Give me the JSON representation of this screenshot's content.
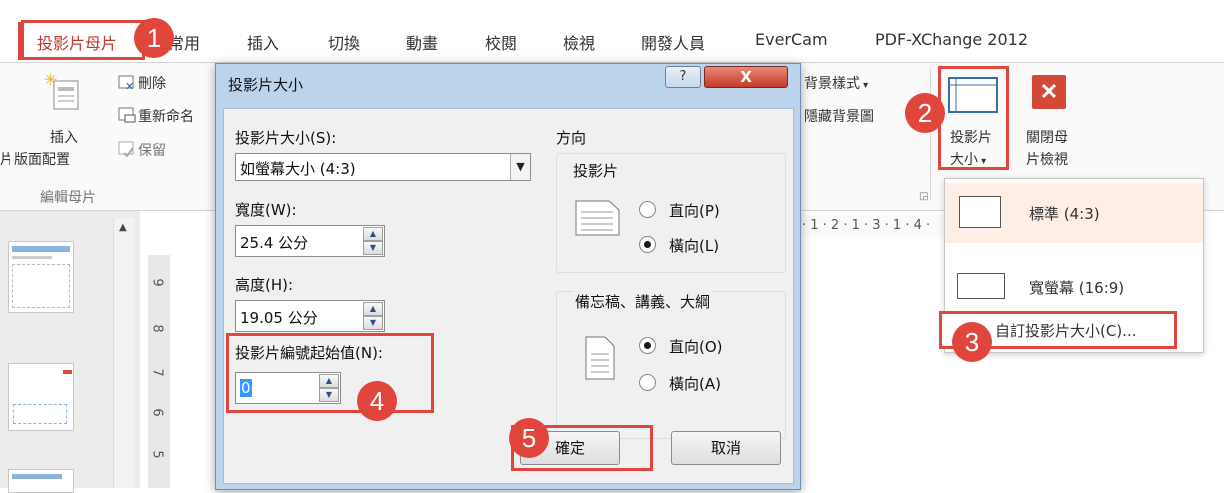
{
  "ribbon_tabs": [
    "投影片母片",
    "常用",
    "插入",
    "切換",
    "動畫",
    "校閱",
    "檢視",
    "開發人員",
    "EverCam",
    "PDF-XChange 2012"
  ],
  "ribbon": {
    "insert_layout_1": "插入",
    "insert_layout_2": "版面配置",
    "left_edge_char": "片",
    "delete": "刪除",
    "rename": "重新命名",
    "preserve": "保留",
    "group_edit_master": "編輯母片",
    "bg_styles": "背景樣式",
    "hide_bg": "隱藏背景圖",
    "slide_size_1": "投影片",
    "slide_size_2": "大小",
    "close_master_1": "關閉母",
    "close_master_2": "片檢視"
  },
  "ruler_marks": "· 1 · 2 · 1 · 3 · 1 · 4 ·",
  "vruler_marks": [
    "9",
    "8",
    "7",
    "6",
    "5"
  ],
  "dialog": {
    "title": "投影片大小",
    "help": "?",
    "close": "X",
    "slide_size_label": "投影片大小(S):",
    "slide_size_value": "如螢幕大小 (4:3)",
    "width_label": "寬度(W):",
    "width_value": "25.4 公分",
    "height_label": "高度(H):",
    "height_value": "19.05 公分",
    "start_number_label": "投影片編號起始值(N):",
    "start_number_value": "0",
    "orientation_title": "方向",
    "slides_group": "投影片",
    "slides_portrait": "直向(P)",
    "slides_landscape": "橫向(L)",
    "notes_group": "備忘稿、講義、大綱",
    "notes_portrait": "直向(O)",
    "notes_landscape": "橫向(A)",
    "ok": "確定",
    "cancel": "取消"
  },
  "dropdown": {
    "standard": "標準 (4:3)",
    "widescreen": "寬螢幕 (16:9)",
    "custom": "自訂投影片大小(C)..."
  },
  "badges": [
    "1",
    "2",
    "3",
    "4",
    "5"
  ],
  "colors": {
    "annotation_red": "#e0463c",
    "dialog_frame": "#bcd3ec",
    "close_red": "#c33a26"
  }
}
